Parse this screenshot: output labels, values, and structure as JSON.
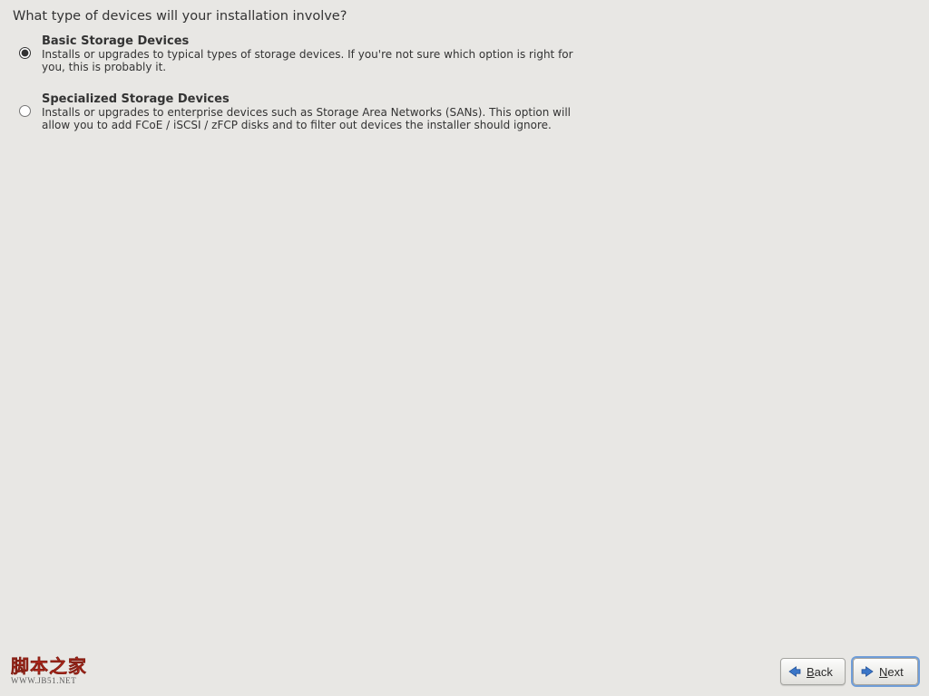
{
  "heading": "What type of devices will your installation involve?",
  "options": {
    "basic": {
      "title": "Basic Storage Devices",
      "desc": "Installs or upgrades to typical types of storage devices.  If you're not sure which option is right for you, this is probably it."
    },
    "specialized": {
      "title": "Specialized Storage Devices",
      "desc": "Installs or upgrades to enterprise devices such as Storage Area Networks (SANs). This option will allow you to add FCoE / iSCSI / zFCP disks and to filter out devices the installer should ignore."
    }
  },
  "buttons": {
    "back": "Back",
    "next": "Next"
  },
  "watermark": {
    "line1": "脚本之家",
    "line2": "WWW.JB51.NET"
  }
}
